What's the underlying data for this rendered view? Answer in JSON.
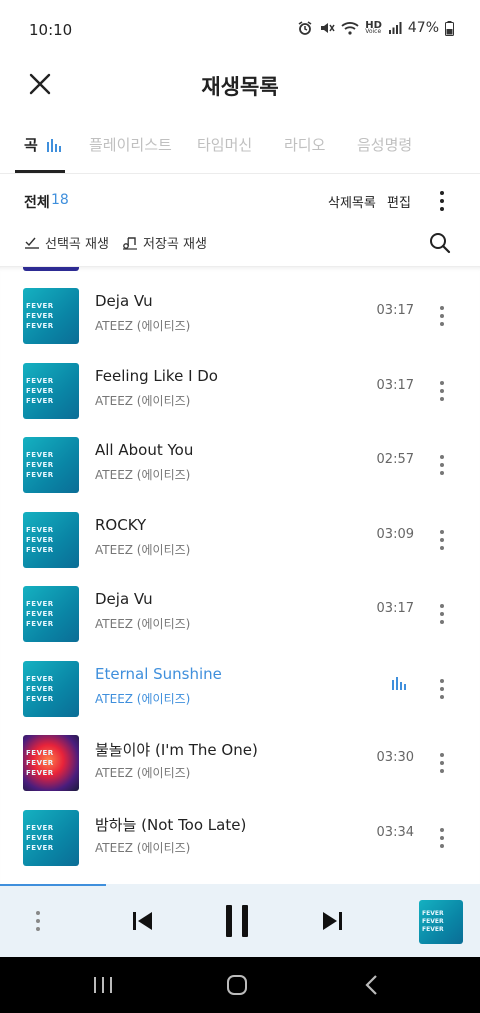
{
  "status_bar": {
    "time": "10:10",
    "network": "HD",
    "network_sub": "Voice",
    "battery": "47%"
  },
  "header": {
    "title": "재생목록"
  },
  "tabs": [
    {
      "label": "곡",
      "active": true
    },
    {
      "label": "플레이리스트",
      "active": false
    },
    {
      "label": "타임머신",
      "active": false
    },
    {
      "label": "라디오",
      "active": false
    },
    {
      "label": "음성명령",
      "active": false
    }
  ],
  "toolbar": {
    "all_label": "전체",
    "count": "18",
    "delete_list": "삭제목록",
    "edit": "편집"
  },
  "actions": {
    "play_selected": "선택곡 재생",
    "play_saved": "저장곡 재생"
  },
  "album_art_text": "FEVER",
  "tracks": [
    {
      "title": "Deja Vu",
      "artist": "ATEEZ (에이티즈)",
      "duration": "03:17",
      "playing": false
    },
    {
      "title": "Feeling Like I Do",
      "artist": "ATEEZ (에이티즈)",
      "duration": "03:17",
      "playing": false
    },
    {
      "title": "All About You",
      "artist": "ATEEZ (에이티즈)",
      "duration": "02:57",
      "playing": false
    },
    {
      "title": "ROCKY",
      "artist": "ATEEZ (에이티즈)",
      "duration": "03:09",
      "playing": false
    },
    {
      "title": "Deja Vu",
      "artist": "ATEEZ (에이티즈)",
      "duration": "03:17",
      "playing": false
    },
    {
      "title": "Eternal Sunshine",
      "artist": "ATEEZ (에이티즈)",
      "duration": "",
      "playing": true
    },
    {
      "title": "불놀이야 (I'm The One)",
      "artist": "ATEEZ (에이티즈)",
      "duration": "03:30",
      "playing": false
    },
    {
      "title": "밤하늘 (Not Too Late)",
      "artist": "ATEEZ (에이티즈)",
      "duration": "03:34",
      "playing": false
    }
  ],
  "player": {
    "progress_fraction": 0.22
  },
  "colors": {
    "accent": "#3f8fdc",
    "player_bg": "#eaf2f8"
  }
}
